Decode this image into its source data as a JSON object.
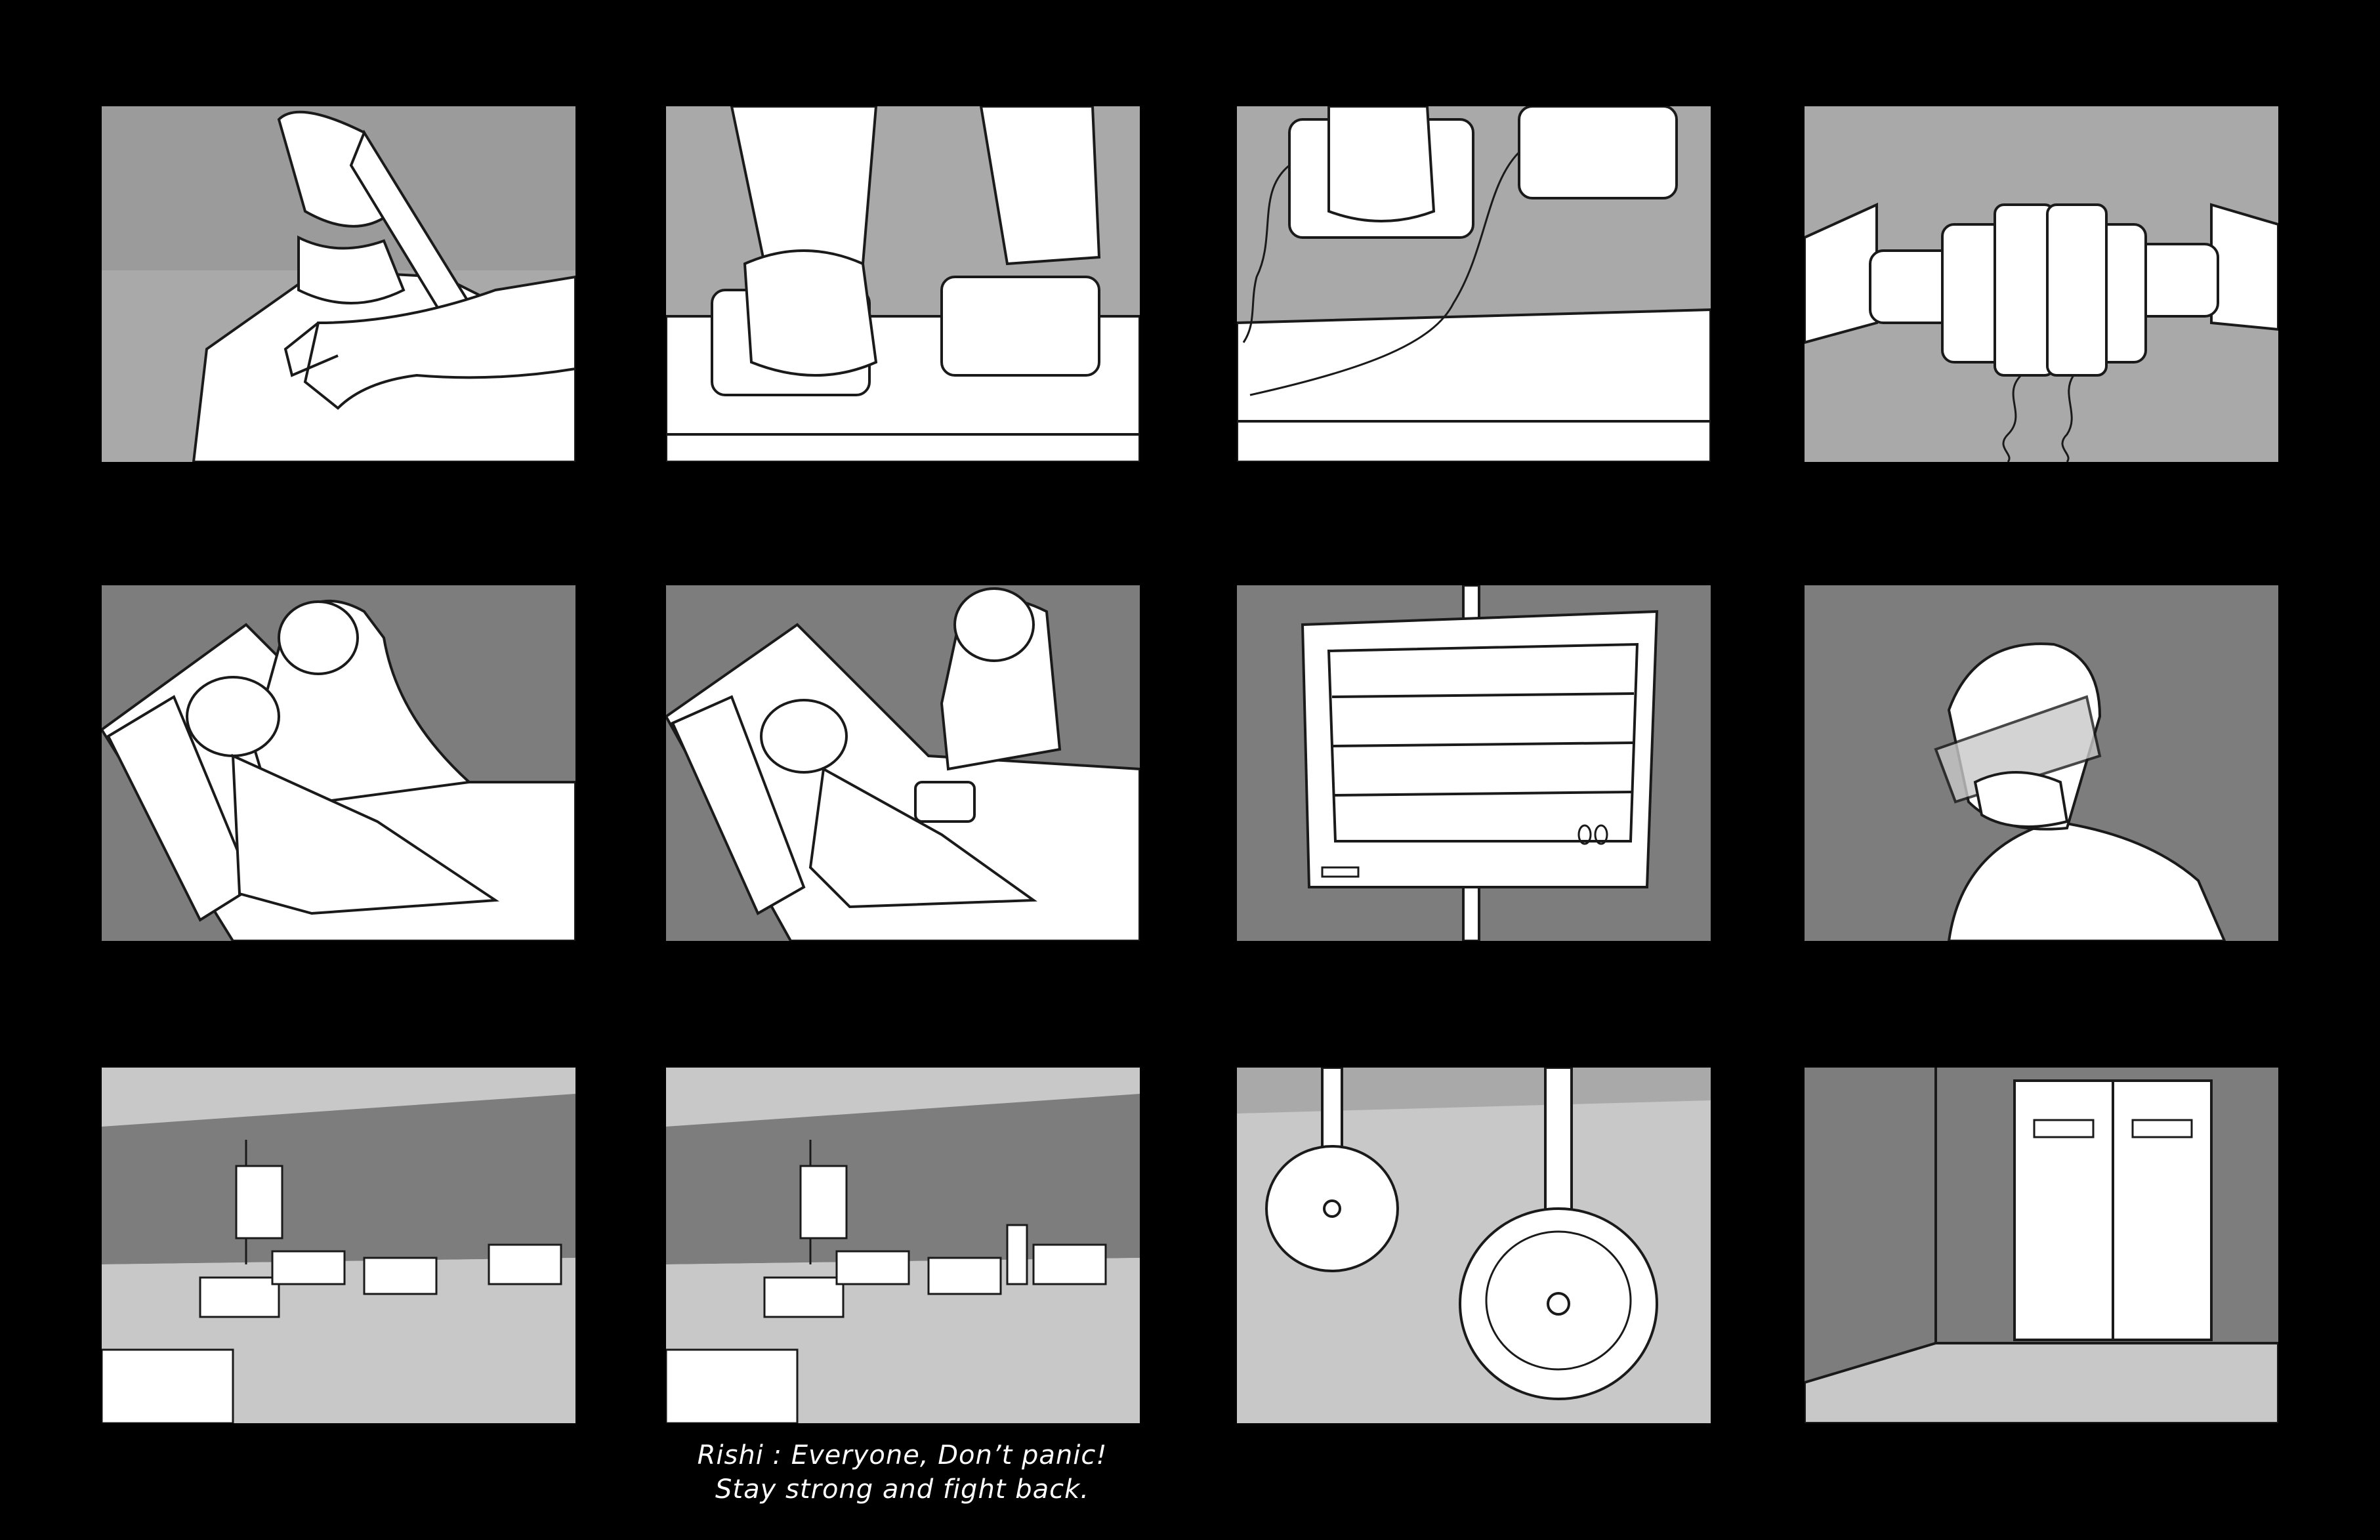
{
  "storyboard": {
    "panels": [
      {
        "id": 1,
        "scene": "hand-on-chest-closeup"
      },
      {
        "id": 2,
        "scene": "fist-on-defibrillator-paddles"
      },
      {
        "id": 3,
        "scene": "paddles-with-coiled-cables"
      },
      {
        "id": 4,
        "scene": "hands-holding-paddles-together"
      },
      {
        "id": 5,
        "scene": "doctor-defibrillating-patient"
      },
      {
        "id": 6,
        "scene": "doctor-over-patient-on-bed"
      },
      {
        "id": 7,
        "scene": "heart-monitor-screen"
      },
      {
        "id": 8,
        "scene": "doctor-with-face-shield"
      },
      {
        "id": 9,
        "scene": "hospital-ward-wide-shot"
      },
      {
        "id": 10,
        "scene": "hospital-ward-doctor-speaking"
      },
      {
        "id": 11,
        "scene": "stretcher-wheels-rolling"
      },
      {
        "id": 12,
        "scene": "double-doors-room-corner"
      }
    ],
    "caption": {
      "line1": "Rishi : Everyone, Don’t panic!",
      "line2": "Stay strong and fight back."
    }
  },
  "colors": {
    "background": "#000000",
    "panel_mid_gray": "#a7a7a7",
    "panel_dark_gray": "#7d7d7d",
    "panel_light_gray": "#c8c8c8",
    "line_art": "#1a1a1a",
    "fill_white": "#ffffff"
  }
}
